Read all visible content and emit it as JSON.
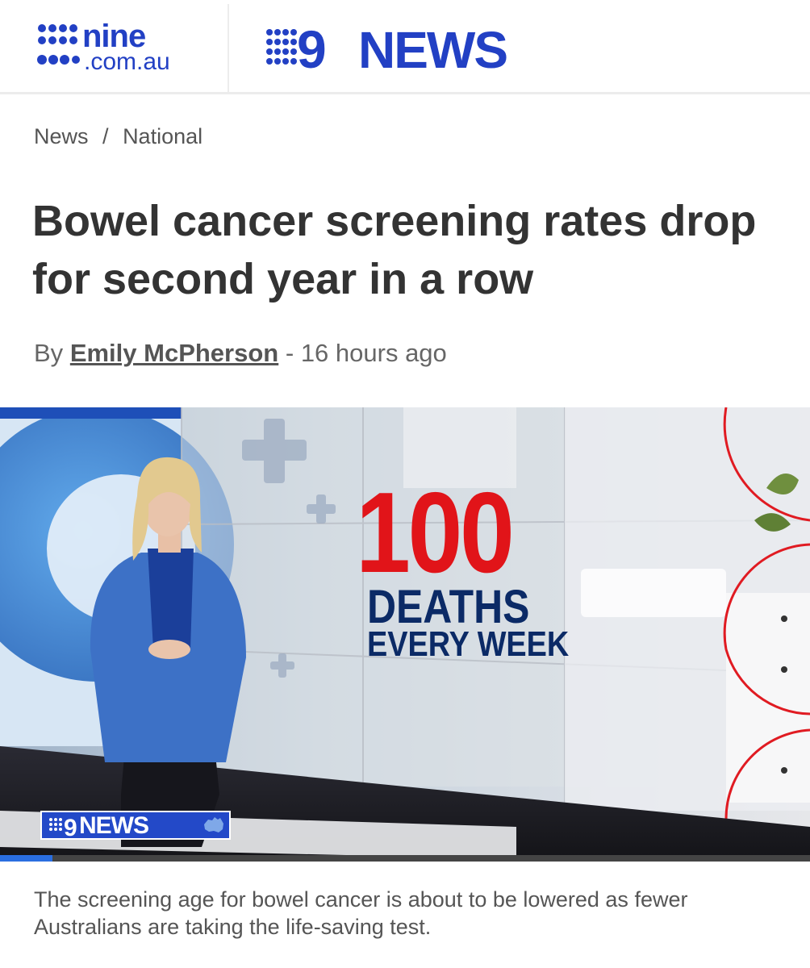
{
  "header": {
    "site_logo": {
      "word": "nine",
      "domain": ".com.au"
    },
    "section_logo": {
      "numeral": "9",
      "word": "NEWS"
    }
  },
  "breadcrumb": {
    "items": [
      "News",
      "National"
    ],
    "separator": "/"
  },
  "article": {
    "title": "Bowel cancer screening rates drop for second year in a row",
    "byline": {
      "prefix": "By",
      "author": "Emily McPherson",
      "dash": "-",
      "time": "16 hours ago"
    },
    "hero": {
      "stat_number": "100",
      "stat_line1": "DEATHS",
      "stat_line2": "EVERY WEEK",
      "watermark": "NEWS",
      "video_progress_fraction": 0.065
    },
    "caption": "The screening age for bowel cancer is about to be lowered as fewer Australians are taking the life-saving test."
  },
  "colors": {
    "brand_blue": "#2240c4",
    "stat_red": "#e11419",
    "stat_navy": "#0b2a66",
    "text": "#333333"
  },
  "icons": [
    "nine-logo-dots",
    "nine-news-logo",
    "australia-map-icon"
  ]
}
